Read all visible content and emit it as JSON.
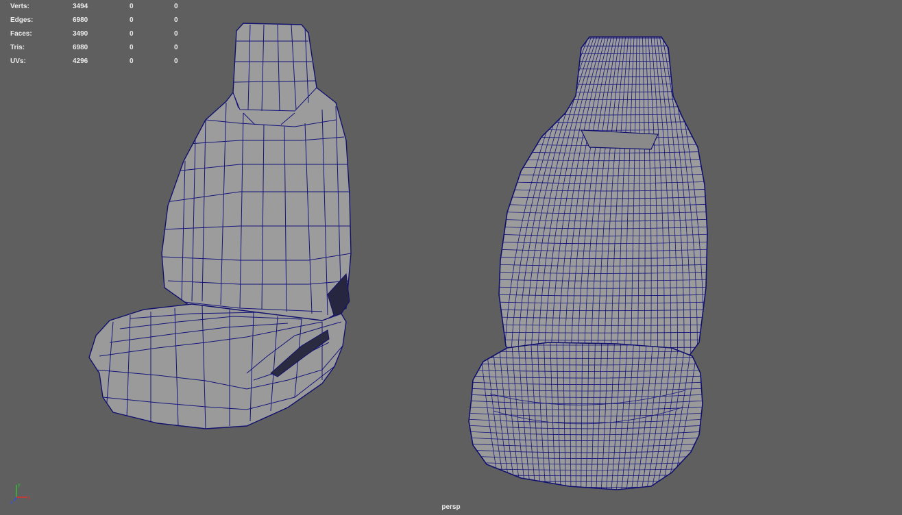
{
  "hud": {
    "rows": [
      {
        "label": "Verts:",
        "total": "3494",
        "selected": "0",
        "component": "0"
      },
      {
        "label": "Edges:",
        "total": "6980",
        "selected": "0",
        "component": "0"
      },
      {
        "label": "Faces:",
        "total": "3490",
        "selected": "0",
        "component": "0"
      },
      {
        "label": "Tris:",
        "total": "6980",
        "selected": "0",
        "component": "0"
      },
      {
        "label": "UVs:",
        "total": "4296",
        "selected": "0",
        "component": "0"
      }
    ]
  },
  "viewport": {
    "camera": "persp",
    "background_color": "#5f5f5f",
    "mesh_fill_color": "#9b9b9b",
    "wireframe_color": "#1a1a7a"
  },
  "axis_gizmo": {
    "x_color": "#e03030",
    "y_color": "#30c030",
    "z_color": "#3050e0",
    "x_label": "x",
    "y_label": "y",
    "z_label": "z"
  },
  "models": [
    {
      "name": "low-poly seat"
    },
    {
      "name": "high-poly seat"
    }
  ]
}
